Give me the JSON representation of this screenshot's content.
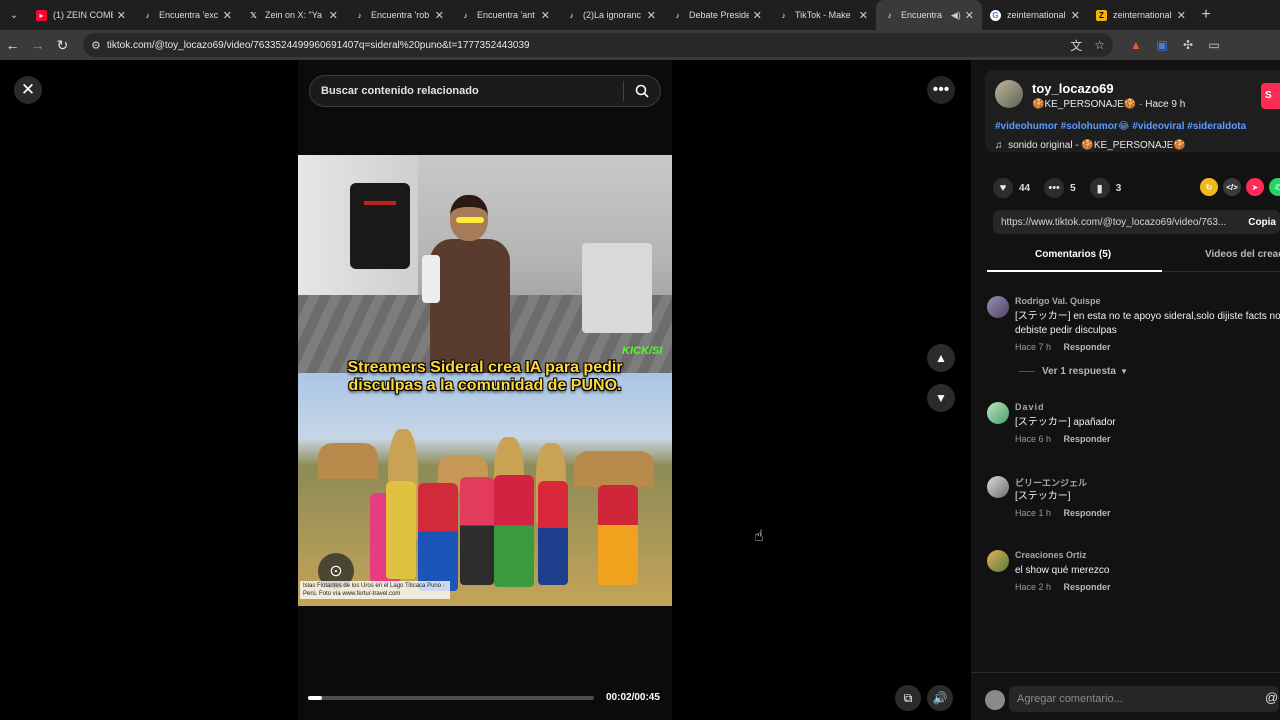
{
  "browser": {
    "tabs": [
      {
        "title": "(1) ZEIN COME",
        "icon": "youtube-icon",
        "color": "#ff0033"
      },
      {
        "title": "Encuentra 'exc",
        "icon": "tiktok-icon",
        "color": "#000000"
      },
      {
        "title": "Zein on X: \"Ya",
        "icon": "x-icon",
        "color": "#000000"
      },
      {
        "title": "Encuentra 'rob",
        "icon": "tiktok-icon",
        "color": "#000000"
      },
      {
        "title": "Encuentra 'ant",
        "icon": "tiktok-icon",
        "color": "#000000"
      },
      {
        "title": "(2)La ignoranc",
        "icon": "tiktok-icon",
        "color": "#000000"
      },
      {
        "title": "Debate Preside",
        "icon": "tiktok-icon",
        "color": "#000000"
      },
      {
        "title": "TikTok - Make",
        "icon": "tiktok-icon",
        "color": "#000000"
      },
      {
        "title": "Encuentra",
        "icon": "tiktok-icon",
        "color": "#000000",
        "active": true
      },
      {
        "title": "zeinternational",
        "icon": "google-icon",
        "color": "#4285f4"
      },
      {
        "title": "zeinternational",
        "icon": "zapier-icon",
        "color": "#f5b301"
      }
    ],
    "url": "tiktok.com/@toy_locazo69/video/7633524499960691407q=sideral%20puno&t=1777352443039"
  },
  "search": {
    "placeholder": "Buscar contenido relacionado"
  },
  "video": {
    "caption": "Streamers Sideral crea IA para pedir disculpas a la comunidad de PUNO.",
    "overlay_tag": "KICK/SI",
    "credit": "Islas Flotantes de los Uros en el Lago Titicaca Puno - Perú. Foto vía www.fertur-travel.com",
    "time": "00:02/00:45",
    "progress": 0.05
  },
  "post": {
    "username": "toy_locazo69",
    "meta": "🍪KE_PERSONAJE🍪 · Hace 9 h",
    "follow_label": "S",
    "hashtags": "#videohumor #solohumor😂 #videoviral #sideraldota",
    "sound": "sonido original - 🍪KE_PERSONAJE🍪",
    "likes": "44",
    "comments": "5",
    "saves": "3",
    "link": "https://www.tiktok.com/@toy_locazo69/video/763...",
    "copy_label": "Copia"
  },
  "tabs2": {
    "comments": "Comentarios (5)",
    "creator": "Videos del creador"
  },
  "comments": [
    {
      "user": "Rodrigo Val. Quispe",
      "text": "[ステッカー] en esta no te apoyo sideral,solo dijiste facts no debiste pedir disculpas",
      "time": "Hace 7 h",
      "reply": "Responder"
    },
    {
      "user": "David",
      "text": "[ステッカー] apañador",
      "time": "Hace 6 h",
      "reply": "Responder"
    },
    {
      "user": "ビリーエンジェル",
      "text": "[ステッカー]",
      "time": "Hace 1 h",
      "reply": "Responder"
    },
    {
      "user": "Creaciones Ortiz",
      "text": "el show qué merezco",
      "time": "Hace 2 h",
      "reply": "Responder"
    }
  ],
  "replies_label": "Ver 1 respuesta",
  "compose": {
    "placeholder": "Agregar comentario..."
  }
}
